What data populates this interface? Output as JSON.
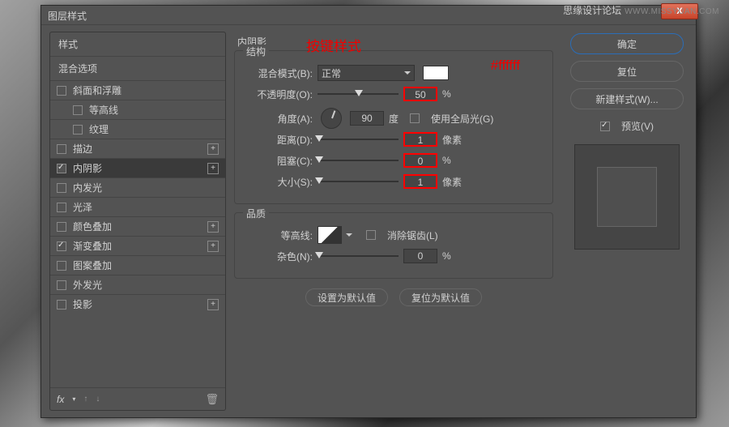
{
  "watermark": {
    "line1": "思缘设计论坛",
    "line2": "WWW.MISSYUAN.COM"
  },
  "window": {
    "title": "图层样式",
    "close": "X"
  },
  "sidebar": {
    "styles_header": "样式",
    "blend_header": "混合选项",
    "items": [
      {
        "label": "斜面和浮雕",
        "checked": false,
        "plus": false,
        "indent": false
      },
      {
        "label": "等高线",
        "checked": false,
        "plus": false,
        "indent": true
      },
      {
        "label": "纹理",
        "checked": false,
        "plus": false,
        "indent": true
      },
      {
        "label": "描边",
        "checked": false,
        "plus": true,
        "indent": false
      },
      {
        "label": "内阴影",
        "checked": true,
        "plus": true,
        "indent": false,
        "selected": true
      },
      {
        "label": "内发光",
        "checked": false,
        "plus": false,
        "indent": false
      },
      {
        "label": "光泽",
        "checked": false,
        "plus": false,
        "indent": false
      },
      {
        "label": "颜色叠加",
        "checked": false,
        "plus": true,
        "indent": false
      },
      {
        "label": "渐变叠加",
        "checked": true,
        "plus": true,
        "indent": false
      },
      {
        "label": "图案叠加",
        "checked": false,
        "plus": false,
        "indent": false
      },
      {
        "label": "外发光",
        "checked": false,
        "plus": false,
        "indent": false
      },
      {
        "label": "投影",
        "checked": false,
        "plus": true,
        "indent": false
      }
    ],
    "footer": {
      "fx": "fx"
    }
  },
  "panel": {
    "title": "内阴影",
    "annot1": "按键样式",
    "annot2": "#ffffff",
    "structure": {
      "legend": "结构",
      "blend_label": "混合模式(B):",
      "blend_value": "正常",
      "opacity_label": "不透明度(O):",
      "opacity_value": "50",
      "opacity_unit": "%",
      "angle_label": "角度(A):",
      "angle_value": "90",
      "angle_unit": "度",
      "global_label": "使用全局光(G)",
      "distance_label": "距离(D):",
      "distance_value": "1",
      "distance_unit": "像素",
      "choke_label": "阻塞(C):",
      "choke_value": "0",
      "choke_unit": "%",
      "size_label": "大小(S):",
      "size_value": "1",
      "size_unit": "像素"
    },
    "quality": {
      "legend": "品质",
      "contour_label": "等高线:",
      "aa_label": "消除锯齿(L)",
      "noise_label": "杂色(N):",
      "noise_value": "0",
      "noise_unit": "%"
    },
    "buttons": {
      "default": "设置为默认值",
      "reset": "复位为默认值"
    }
  },
  "right": {
    "ok": "确定",
    "cancel": "复位",
    "newstyle": "新建样式(W)...",
    "preview": "预览(V)"
  }
}
